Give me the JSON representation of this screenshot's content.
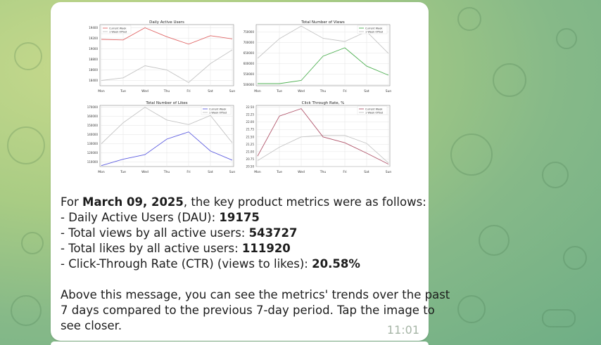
{
  "chat": {
    "colors": {
      "bubble": "#ffffff",
      "current_week": "#e06666",
      "offset": "#b9b9b9"
    },
    "message": {
      "intro_prefix": "For ",
      "date": "March 09, 2025",
      "intro_suffix": ", the key product metrics were as follows:",
      "dau_label": "- Daily Active Users (DAU): ",
      "dau_value": "19175",
      "views_label": "- Total views by all active users: ",
      "views_value": "543727",
      "likes_label": "- Total likes by all active users: ",
      "likes_value": "111920",
      "ctr_label": "- Click-Through Rate (CTR) (views to likes): ",
      "ctr_value": "20.58%",
      "footer_line1": "Above this message, you can see the metrics' trends over the past",
      "footer_line2": "7 days compared to the previous 7-day period. Tap the image to",
      "footer_line3": "see closer."
    },
    "time": "11:01"
  },
  "chart_data": [
    {
      "type": "line",
      "title": "Daily Active Users",
      "categories": [
        "Mon",
        "Tue",
        "Wed",
        "Thu",
        "Fri",
        "Sat",
        "Sun"
      ],
      "yticks": [
        "18400",
        "18600",
        "18800",
        "19000",
        "19200",
        "19400"
      ],
      "ylim": [
        18300,
        19460
      ],
      "series": [
        {
          "name": "Current Week",
          "color": "#e06666",
          "values": [
            19180,
            19170,
            19400,
            19230,
            19090,
            19250,
            19190
          ]
        },
        {
          "name": "1 Week Offset",
          "color": "#c4c4c4",
          "values": [
            18400,
            18450,
            18680,
            18600,
            18360,
            18720,
            18980
          ]
        }
      ],
      "legend": "top-left"
    },
    {
      "type": "line",
      "title": "Total Number of Views",
      "categories": [
        "Mon",
        "Tue",
        "Wed",
        "Thu",
        "Fri",
        "Sat",
        "Sun"
      ],
      "yticks": [
        "500000",
        "550000",
        "600000",
        "650000",
        "700000",
        "750000"
      ],
      "ylim": [
        495000,
        785000
      ],
      "series": [
        {
          "name": "Current Week",
          "color": "#4caf50",
          "values": [
            505000,
            505000,
            520000,
            635000,
            675000,
            588000,
            545000
          ]
        },
        {
          "name": "1 Week Offset",
          "color": "#c4c4c4",
          "values": [
            625000,
            718000,
            778000,
            720000,
            705000,
            752000,
            648000
          ]
        }
      ],
      "legend": "top-right"
    },
    {
      "type": "line",
      "title": "Total Number of Likes",
      "categories": [
        "Mon",
        "Tue",
        "Wed",
        "Thu",
        "Fri",
        "Sat",
        "Sun"
      ],
      "yticks": [
        "110000",
        "120000",
        "130000",
        "140000",
        "150000",
        "160000",
        "170000"
      ],
      "ylim": [
        105000,
        172000
      ],
      "series": [
        {
          "name": "Current Week",
          "color": "#5c5ce0",
          "values": [
            106000,
            113000,
            118000,
            135000,
            143000,
            122000,
            112000
          ]
        },
        {
          "name": "1 Week Offset",
          "color": "#c4c4c4",
          "values": [
            130000,
            153000,
            170000,
            156000,
            151000,
            161000,
            131000
          ]
        }
      ],
      "legend": "top-right"
    },
    {
      "type": "line",
      "title": "Click Through Rate, %",
      "categories": [
        "Mon",
        "Tue",
        "Wed",
        "Thu",
        "Fri",
        "Sat",
        "Sun"
      ],
      "yticks": [
        "20.50",
        "20.75",
        "21.00",
        "21.25",
        "21.50",
        "21.75",
        "22.00",
        "22.25",
        "22.50"
      ],
      "ylim": [
        20.5,
        22.56
      ],
      "series": [
        {
          "name": "Current Week",
          "color": "#b0546a",
          "values": [
            20.85,
            22.2,
            22.45,
            21.5,
            21.3,
            20.95,
            20.58
          ]
        },
        {
          "name": "1 Week Offset",
          "color": "#c4c4c4",
          "values": [
            20.7,
            21.15,
            21.5,
            21.55,
            21.55,
            21.28,
            20.62
          ]
        }
      ],
      "legend": "top-right"
    }
  ]
}
